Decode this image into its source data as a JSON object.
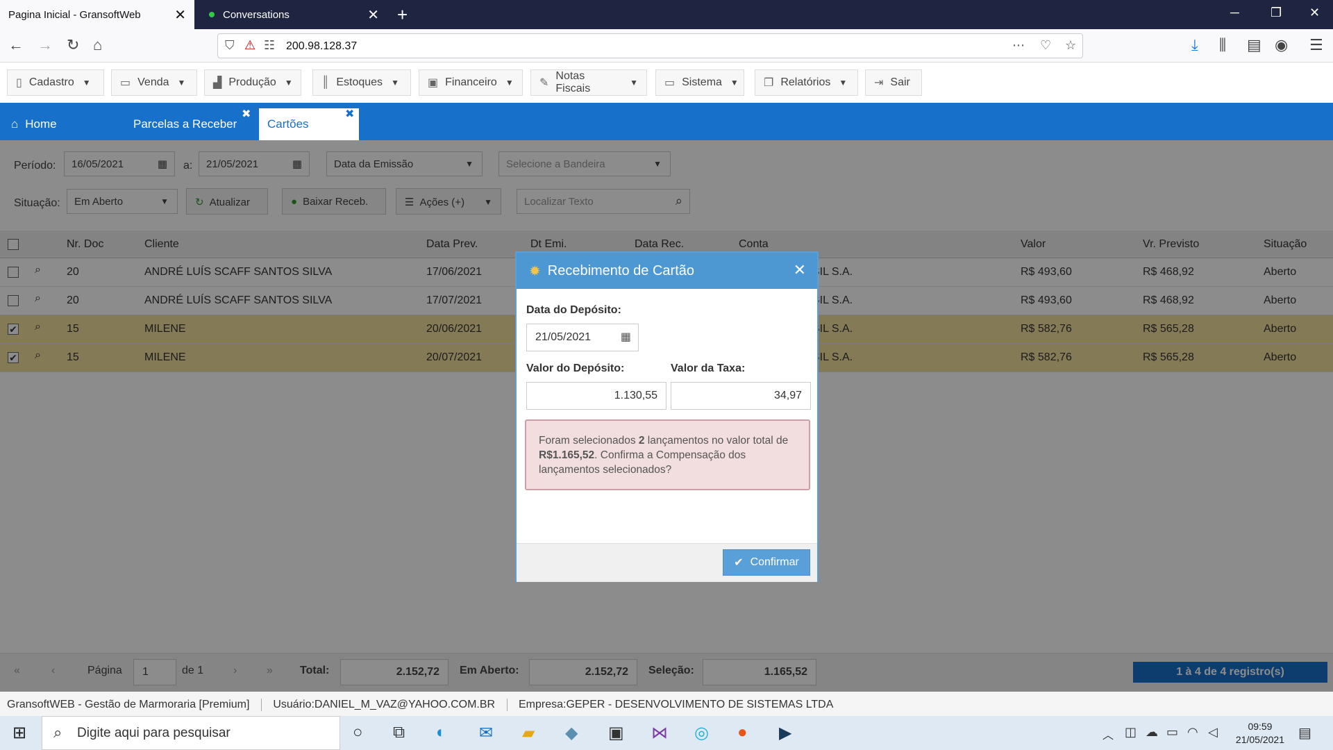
{
  "browser": {
    "tabs": [
      {
        "title": "Pagina Inicial - GransoftWeb",
        "close": "✕"
      },
      {
        "title": "Conversations",
        "close": "✕"
      }
    ],
    "url": "200.98.128.37"
  },
  "menu": {
    "items": [
      {
        "label": "Cadastro"
      },
      {
        "label": "Venda"
      },
      {
        "label": "Produção"
      },
      {
        "label": "Estoques"
      },
      {
        "label": "Financeiro"
      },
      {
        "label": "Notas Fiscais"
      },
      {
        "label": "Sistema"
      },
      {
        "label": "Relatórios"
      },
      {
        "label": "Sair"
      }
    ]
  },
  "apptabs": {
    "home": "Home",
    "parcelas": "Parcelas a Receber",
    "cartoes": "Cartões"
  },
  "filters": {
    "periodo_label": "Período:",
    "date_from": "16/05/2021",
    "a_label": "a:",
    "date_to": "21/05/2021",
    "date_type": "Data da Emissão",
    "bandeira_placeholder": "Selecione a Bandeira",
    "situacao_label": "Situação:",
    "situacao_value": "Em Aberto",
    "atualizar": "Atualizar",
    "baixar": "Baixar Receb.",
    "acoes": "Ações (+)",
    "search_placeholder": "Localizar Texto"
  },
  "table": {
    "headers": [
      "Nr. Doc",
      "Cliente",
      "Data Prev.",
      "Dt Emi.",
      "Data Rec.",
      "Conta",
      "Valor",
      "Vr. Previsto",
      "Situação"
    ],
    "rows": [
      {
        "doc": "20",
        "cliente": "ANDRÉ LUÍS SCAFF SANTOS SILVA",
        "data_prev": "17/06/2021",
        "conta": "SIL S.A.",
        "valor": "R$ 493,60",
        "previsto": "R$ 468,92",
        "situacao": "Aberto",
        "checked": false
      },
      {
        "doc": "20",
        "cliente": "ANDRÉ LUÍS SCAFF SANTOS SILVA",
        "data_prev": "17/07/2021",
        "conta": "SIL S.A.",
        "valor": "R$ 493,60",
        "previsto": "R$ 468,92",
        "situacao": "Aberto",
        "checked": false
      },
      {
        "doc": "15",
        "cliente": "MILENE",
        "data_prev": "20/06/2021",
        "conta": "SIL S.A.",
        "valor": "R$ 582,76",
        "previsto": "R$ 565,28",
        "situacao": "Aberto",
        "checked": true
      },
      {
        "doc": "15",
        "cliente": "MILENE",
        "data_prev": "20/07/2021",
        "conta": "SIL S.A.",
        "valor": "R$ 582,76",
        "previsto": "R$ 565,28",
        "situacao": "Aberto",
        "checked": true
      }
    ]
  },
  "footer": {
    "pagina_label": "Página",
    "page": "1",
    "de_label": "de 1",
    "total_label": "Total:",
    "total": "2.152,72",
    "aberto_label": "Em Aberto:",
    "aberto": "2.152,72",
    "selecao_label": "Seleção:",
    "selecao": "1.165,52",
    "records": "1 à 4 de 4 registro(s)"
  },
  "modal": {
    "title": "Recebimento de Cartão",
    "data_label": "Data do Depósito:",
    "data_value": "21/05/2021",
    "valor_label": "Valor do Depósito:",
    "valor_value": "1.130,55",
    "taxa_label": "Valor da Taxa:",
    "taxa_value": "34,97",
    "alert_pre": "Foram selecionados ",
    "alert_count": "2",
    "alert_mid": " lançamentos no valor total de ",
    "alert_total": "R$1.165,52",
    "alert_post": ". Confirma a Compensação dos lançamentos selecionados?",
    "confirm": "Confirmar"
  },
  "status": {
    "app_bold": "GransoftWEB",
    "app_rest": " - Gestão de Marmoraria [Premium]",
    "usuario": "Usuário:DANIEL_M_VAZ@YAHOO.COM.BR",
    "empresa": "Empresa:GEPER - DESENVOLVIMENTO DE SISTEMAS LTDA"
  },
  "taskbar": {
    "search_placeholder": "Digite aqui para pesquisar",
    "time": "09:59",
    "date": "21/05/2021"
  },
  "colors": {
    "brand_blue": "#1770c9",
    "modal_header": "#4d97d3",
    "selected_row": "#f3df9d",
    "alert_bg": "#f2dede"
  }
}
